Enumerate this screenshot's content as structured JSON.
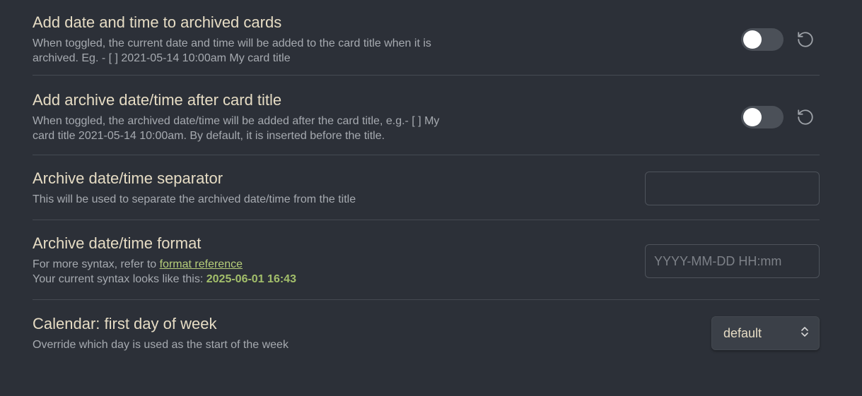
{
  "settings": [
    {
      "title": "Add date and time to archived cards",
      "description": "When toggled, the current date and time will be added to the card title when it is archived. Eg. - [ ] 2021-05-14 10:00am My card title",
      "toggle_on": false
    },
    {
      "title": "Add archive date/time after card title",
      "description": "When toggled, the archived date/time will be added after the card title, e.g.- [ ] My card title 2021-05-14 10:00am. By default, it is inserted before the title.",
      "toggle_on": false
    },
    {
      "title": "Archive date/time separator",
      "description": "This will be used to separate the archived date/time from the title",
      "value": ""
    },
    {
      "title": "Archive date/time format",
      "description_prefix": "For more syntax, refer to ",
      "link_text": "format reference",
      "syntax_prefix": "Your current syntax looks like this: ",
      "syntax_example": "2025-06-01 16:43",
      "placeholder": "YYYY-MM-DD HH:mm",
      "value": ""
    },
    {
      "title": "Calendar: first day of week",
      "description": "Override which day is used as the start of the week",
      "selected": "default"
    }
  ],
  "icons": {
    "reset": "reset-icon",
    "select_chevron": "chevron-up-down-icon"
  },
  "colors": {
    "background": "#2c3038",
    "title": "#e6dcc4",
    "description": "#a6aab0",
    "link": "#b7cf7a",
    "highlight": "#a3bf6b",
    "toggle_off": "#4b5058"
  }
}
